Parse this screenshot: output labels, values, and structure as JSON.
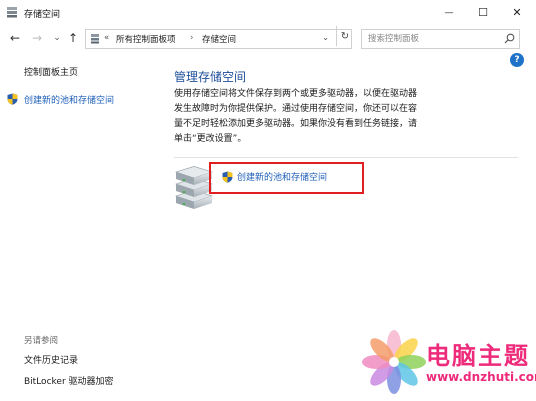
{
  "window": {
    "title": "存储空间",
    "minimize_glyph": "—",
    "maximize_glyph": "☐",
    "close_glyph": "✕"
  },
  "nav": {
    "back_glyph": "←",
    "forward_glyph": "→",
    "history_glyph": "⌄",
    "up_glyph": "↑"
  },
  "address": {
    "chevrons": "«",
    "crumb_1": "所有控制面板项",
    "separator": "›",
    "crumb_2": "存储空间",
    "dropdown_glyph": "⌄",
    "refresh_glyph": "↻"
  },
  "search": {
    "placeholder": "搜索控制面板"
  },
  "help": {
    "label": "?"
  },
  "sidebar": {
    "home_link": "控制面板主页",
    "create_link": "创建新的池和存储空间",
    "see_also_heading": "另请参阅",
    "file_history": "文件历史记录",
    "bitlocker": "BitLocker 驱动器加密"
  },
  "main": {
    "title": "管理存储空间",
    "desc_lines": [
      "使用存储空间将文件保存到两个或更多驱动器，以便在驱动器",
      "发生故障时为你提供保护。通过使用存储空间，你还可以在容",
      "量不足时轻松添加更多驱动器。如果你没有看到任务链接，请",
      "单击“更改设置”。"
    ],
    "create_link": "创建新的池和存储空间"
  },
  "watermark": {
    "title": "电脑主题",
    "url": "www.dnzhuti.com"
  },
  "colors": {
    "accent": "#1e5fb8",
    "highlight_border": "#e02020",
    "watermark": "#ee2a7b"
  }
}
